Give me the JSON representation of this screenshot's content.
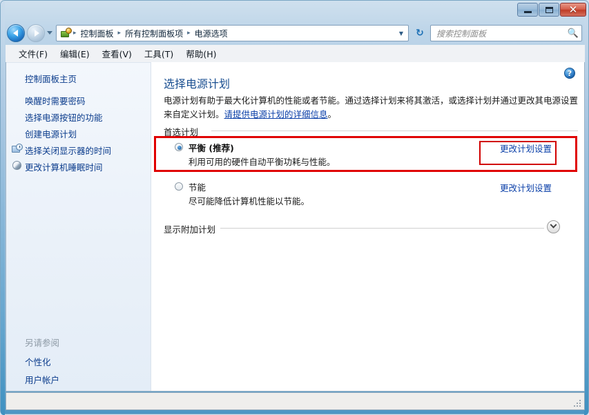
{
  "window": {
    "controls": {
      "minimize": "—",
      "maximize": "□",
      "close": "✕"
    }
  },
  "nav": {
    "back_icon": "back-arrow-icon",
    "forward_icon": "forward-arrow-icon",
    "history_icon": "history-dropdown-icon",
    "address_icon": "control-panel-icon",
    "breadcrumbs": [
      "控制面板",
      "所有控制面板项",
      "电源选项"
    ],
    "separator": "▸",
    "address_dropdown": "▼",
    "refresh_icon": "↻",
    "search": {
      "placeholder": "搜索控制面板",
      "icon": "search-icon"
    }
  },
  "menubar": {
    "items": [
      "文件(F)",
      "编辑(E)",
      "查看(V)",
      "工具(T)",
      "帮助(H)"
    ]
  },
  "sidebar": {
    "home": "控制面板主页",
    "links": [
      {
        "label": "唤醒时需要密码",
        "icon": null
      },
      {
        "label": "选择电源按钮的功能",
        "icon": null
      },
      {
        "label": "创建电源计划",
        "icon": null
      },
      {
        "label": "选择关闭显示器的时间",
        "icon": "monitor-clock-icon"
      },
      {
        "label": "更改计算机睡眠时间",
        "icon": "moon-sleep-icon"
      }
    ],
    "see_also_heading": "另请参阅",
    "see_also": [
      "个性化",
      "用户帐户"
    ]
  },
  "main": {
    "help_icon": "?",
    "title": "选择电源计划",
    "description_before": "电源计划有助于最大化计算机的性能或者节能。通过选择计划来将其激活，或选择计划并通过更改其电源设置来自定义计划。",
    "description_link": "请提供电源计划的详细信息",
    "description_after": "。",
    "group_label": "首选计划",
    "plans": [
      {
        "name": "平衡 (推荐)",
        "description": "利用可用的硬件自动平衡功耗与性能。",
        "selected": true,
        "link": "更改计划设置"
      },
      {
        "name": "节能",
        "description": "尽可能降低计算机性能以节能。",
        "selected": false,
        "link": "更改计划设置"
      }
    ],
    "show_more_label": "显示附加计划",
    "chevron_icon": "chevron-down-icon"
  },
  "annotations": {
    "outer_highlight_color": "#e00000",
    "inner_highlight_color": "#d10000"
  }
}
